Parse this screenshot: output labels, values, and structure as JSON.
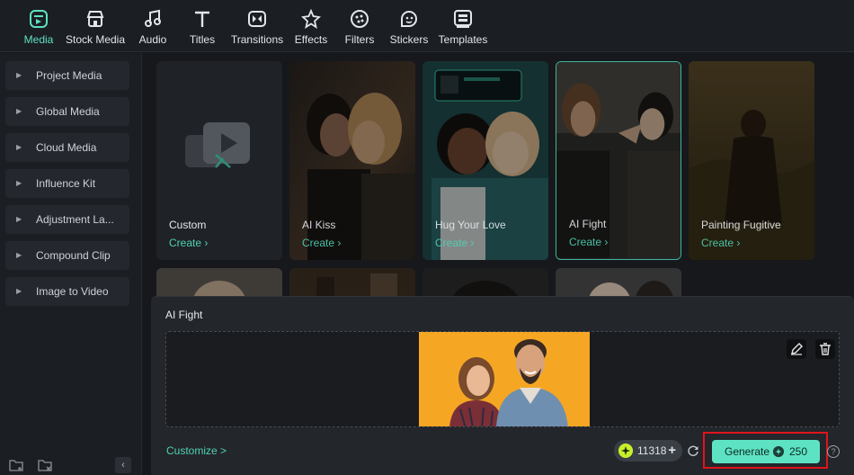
{
  "toolbar": {
    "tabs": [
      {
        "label": "Media",
        "icon": "media-icon",
        "active": true
      },
      {
        "label": "Stock Media",
        "icon": "stock-media-icon"
      },
      {
        "label": "Audio",
        "icon": "music-note-icon"
      },
      {
        "label": "Titles",
        "icon": "text-t-icon"
      },
      {
        "label": "Transitions",
        "icon": "transition-icon"
      },
      {
        "label": "Effects",
        "icon": "sparkle-star-icon"
      },
      {
        "label": "Filters",
        "icon": "filter-icon"
      },
      {
        "label": "Stickers",
        "icon": "sticker-icon"
      },
      {
        "label": "Templates",
        "icon": "template-icon"
      }
    ]
  },
  "sidebar": {
    "items": [
      {
        "label": "Project Media"
      },
      {
        "label": "Global Media"
      },
      {
        "label": "Cloud Media"
      },
      {
        "label": "Influence Kit"
      },
      {
        "label": "Adjustment La..."
      },
      {
        "label": "Compound Clip"
      },
      {
        "label": "Image to Video"
      }
    ],
    "collapse_glyph": "‹"
  },
  "grid": {
    "cards": [
      {
        "title": "Custom",
        "action": "Create ›"
      },
      {
        "title": "AI Kiss",
        "action": "Create ›"
      },
      {
        "title": "Hug Your Love",
        "action": "Create ›"
      },
      {
        "title": "AI Fight",
        "action": "Create ›",
        "selected": true
      },
      {
        "title": "Painting Fugitive",
        "action": "Create ›"
      }
    ]
  },
  "panel": {
    "title": "AI Fight",
    "customize_label": "Customize >",
    "credits_value": "11318",
    "credits_plus": "+",
    "generate_label": "Generate",
    "generate_cost": "250",
    "help_glyph": "?"
  },
  "colors": {
    "accent": "#5de3c3",
    "highlight_box": "#e0141b",
    "preview_bg": "#f5a623",
    "coin": "#c8f02a"
  }
}
